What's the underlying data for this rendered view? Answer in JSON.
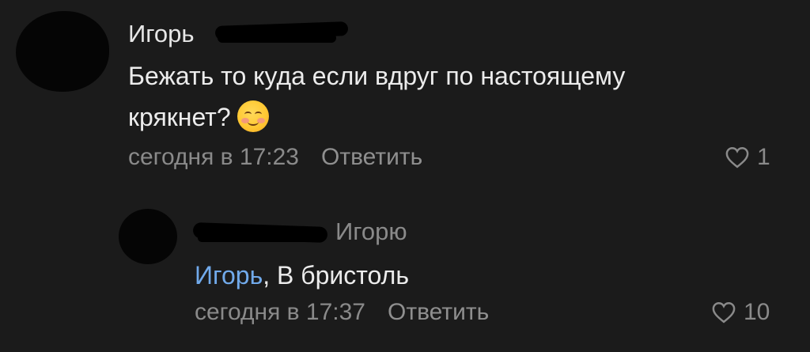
{
  "comment": {
    "author": "Игорь",
    "text": "Бежать то куда если вдруг по настоящему крякнет?",
    "emoji": "smiling-face-icon",
    "time": "сегодня в 17:23",
    "reply_label": "Ответить",
    "likes": "1"
  },
  "reply": {
    "reply_to": "Игорю",
    "mention": "Игорь",
    "text": ", В бристоль",
    "time": "сегодня в 17:37",
    "reply_label": "Ответить",
    "likes": "10"
  },
  "colors": {
    "background": "#1b1b1b",
    "text": "#ececec",
    "secondary": "#8a8a8a",
    "mention": "#71aaeb"
  }
}
